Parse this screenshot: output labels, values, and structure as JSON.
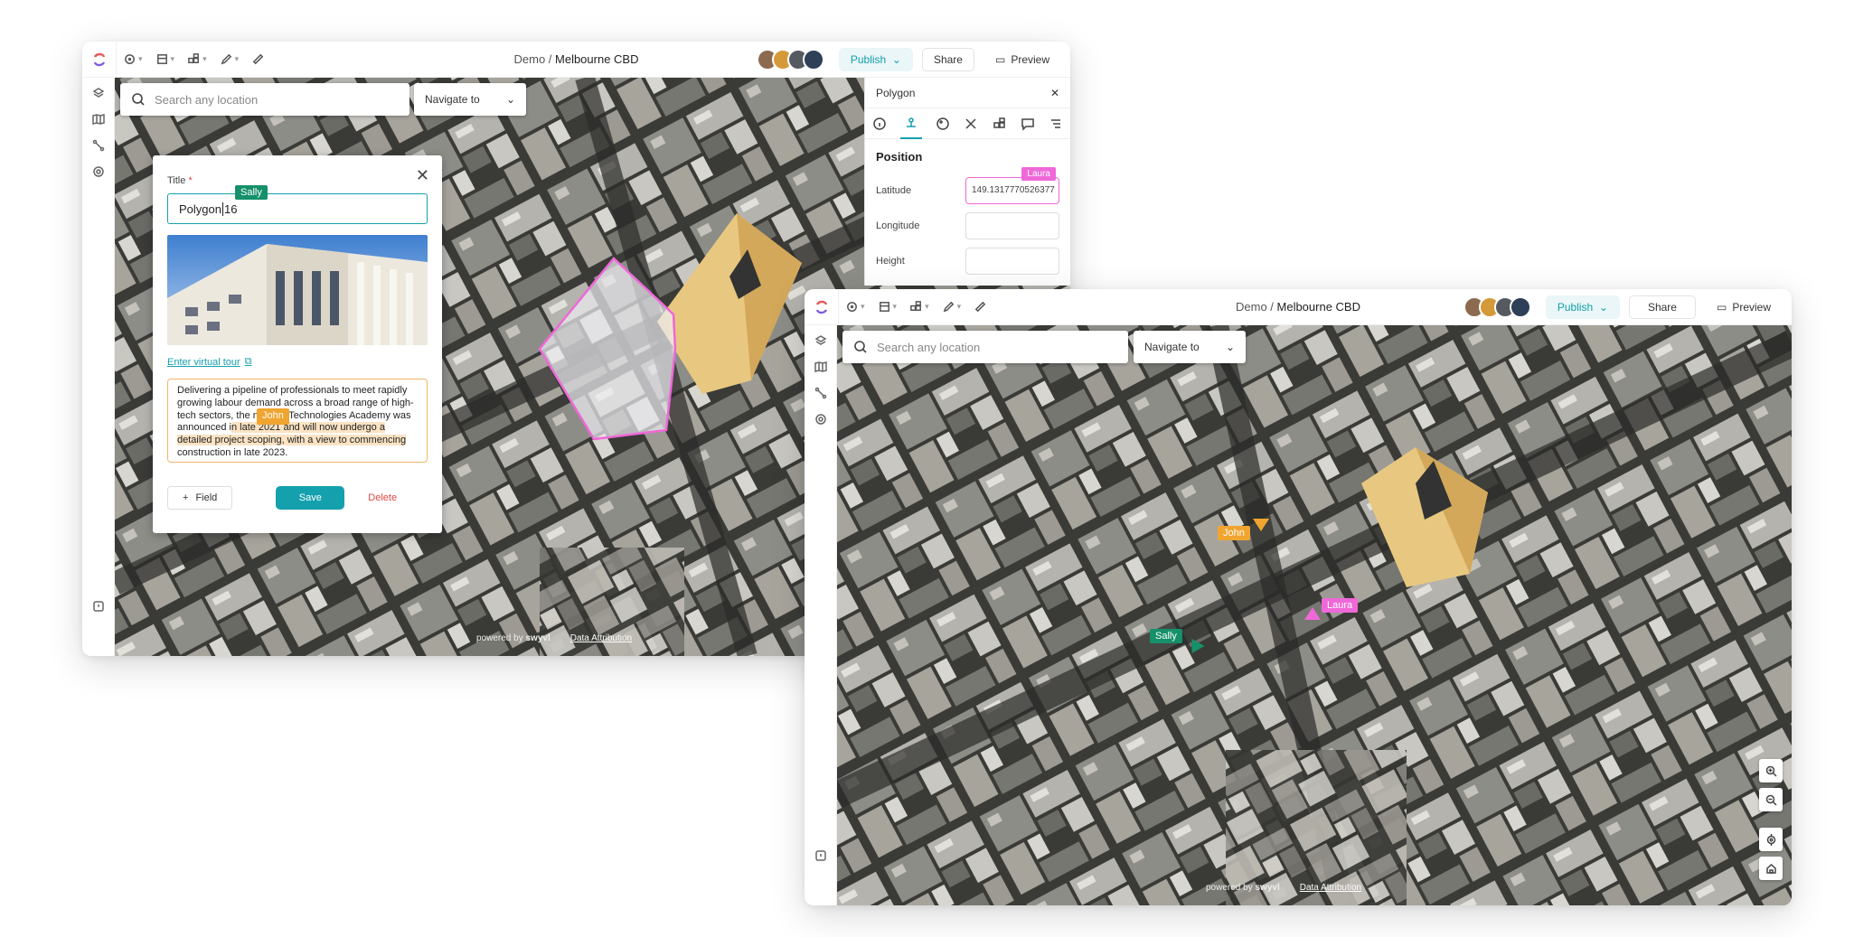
{
  "colors": {
    "teal": "#14a0ad",
    "sally": "#15906a",
    "john": "#f0a530",
    "laura": "#ef68d8",
    "danger": "#e04848"
  },
  "window1": {
    "breadcrumb": {
      "prefix": "Demo / ",
      "project": "Melbourne CBD"
    },
    "search": {
      "placeholder": "Search any location"
    },
    "navigate": {
      "label": "Navigate to"
    },
    "header": {
      "publish": "Publish",
      "share": "Share",
      "preview": "Preview"
    },
    "form": {
      "title_label": "Title",
      "required_mark": "*",
      "title_value_a": "Polygon",
      "title_value_b": "16",
      "virtual_tour": "Enter virtual tour",
      "description": {
        "p1": "Delivering a pipeline of professionals to meet rapidly growing labour demand across a broad range of high-tech sectors, the n",
        "p2": "al Technologies Academy was announced i",
        "p3": "n late 2021 and will now undergo a detailed project scoping, with a view to commencing",
        "p4": " construction in late 2023."
      },
      "field_button": "Field",
      "save_button": "Save",
      "delete_button": "Delete"
    },
    "props": {
      "title": "Polygon",
      "section": "Position",
      "rows": [
        {
          "label": "Latitude",
          "value": "149.1317770526377"
        },
        {
          "label": "Longitude",
          "value": ""
        },
        {
          "label": "Height",
          "value": ""
        }
      ]
    },
    "cursors": {
      "sally": "Sally",
      "john": "John",
      "laura": "Laura"
    },
    "attribution": {
      "powered": "powered by",
      "brand": "swyvl",
      "link": "Data Attribution"
    }
  },
  "window2": {
    "breadcrumb": {
      "prefix": "Demo / ",
      "project": "Melbourne CBD"
    },
    "search": {
      "placeholder": "Search any location"
    },
    "navigate": {
      "label": "Navigate to"
    },
    "header": {
      "publish": "Publish",
      "share": "Share",
      "preview": "Preview"
    },
    "cursors": {
      "sally": "Sally",
      "john": "John",
      "laura": "Laura"
    },
    "attribution": {
      "powered": "powered by",
      "brand": "swyvl",
      "link": "Data Attribution"
    }
  }
}
